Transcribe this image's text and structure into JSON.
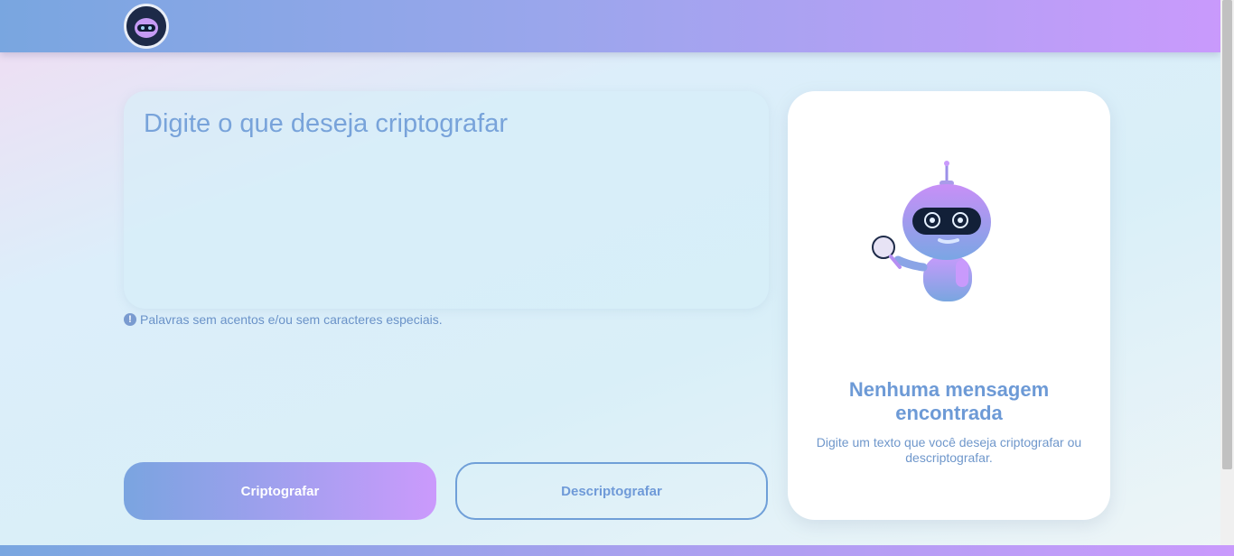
{
  "header": {
    "logo_icon": "robot-logo-icon"
  },
  "input": {
    "placeholder": "Digite o que deseja criptografar",
    "value": ""
  },
  "hint": {
    "icon": "exclamation-icon",
    "text": "Palavras sem acentos e/ou sem caracteres especiais."
  },
  "buttons": {
    "encrypt_label": "Criptografar",
    "decrypt_label": "Descriptografar"
  },
  "output_card": {
    "illustration": "robot-magnifier-icon",
    "title": "Nenhuma mensagem encontrada",
    "text": "Digite um texto que você deseja criptografar ou descriptografar."
  },
  "colors": {
    "accent_blue": "#79a6e0",
    "accent_purple": "#c99afc",
    "text_blue": "#6d9ad6"
  }
}
